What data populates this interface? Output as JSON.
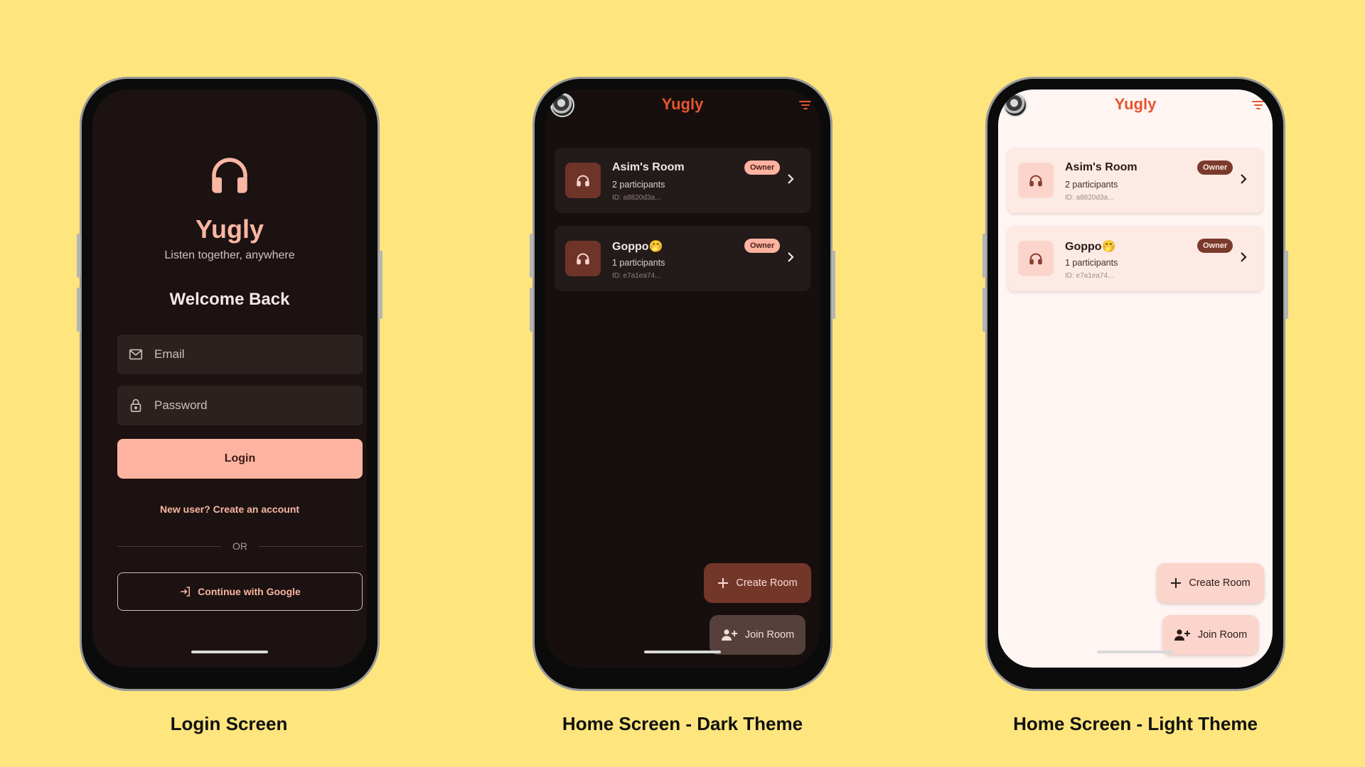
{
  "captions": {
    "login": "Login Screen",
    "dark": "Home Screen - Dark Theme",
    "light": "Home Screen - Light Theme"
  },
  "login": {
    "app_name": "Yugly",
    "tagline": "Listen together, anywhere",
    "welcome": "Welcome Back",
    "email_placeholder": "Email",
    "password_placeholder": "Password",
    "login_label": "Login",
    "signup_link": "New user? Create an account",
    "or_label": "OR",
    "google_label": "Continue with Google",
    "icons": [
      "headphones-icon",
      "mail-icon",
      "lock-icon",
      "login-icon"
    ]
  },
  "home": {
    "title": "Yugly",
    "rooms": [
      {
        "name": "Asim's Room",
        "participants": "2 participants",
        "id": "ID: a8820d3a...",
        "badge": "Owner"
      },
      {
        "name": "Goppo🤭",
        "participants": "1 participants",
        "id": "ID: e7a1ea74...",
        "badge": "Owner"
      }
    ],
    "create_label": "Create Room",
    "join_label": "Join Room",
    "icons": [
      "avatar",
      "filter-icon",
      "headphones-icon",
      "chevron-right-icon",
      "plus-icon",
      "add-person-icon"
    ]
  },
  "colors": {
    "background": "#FEE57D",
    "accent": "#E8552C",
    "login_button": "#FEB3A0",
    "dark_fab_create": "#73372A",
    "light_fab": "#FBD5CB"
  }
}
